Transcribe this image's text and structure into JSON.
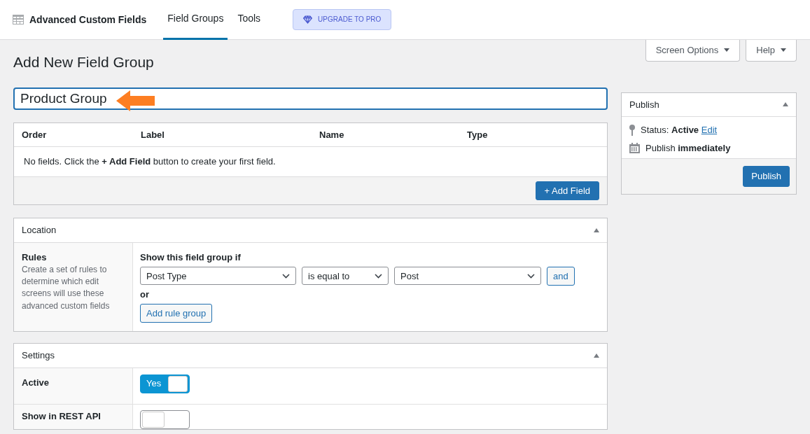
{
  "topbar": {
    "brand": "Advanced Custom Fields",
    "tabs": [
      {
        "label": "Field Groups",
        "selected": true
      },
      {
        "label": "Tools",
        "selected": false
      }
    ],
    "upgrade": "UPGRADE TO PRO"
  },
  "screen_buttons": [
    "Screen Options",
    "Help"
  ],
  "page_title": "Add New Field Group",
  "title_field": {
    "value": "Product Group"
  },
  "fields_table": {
    "columns": [
      "Order",
      "Label",
      "Name",
      "Type"
    ],
    "empty_message": "No fields. Click the **+ Add Field** button to create your first field.",
    "add_button": "+ Add Field"
  },
  "location": {
    "title": "Location",
    "rules_label": "Rules",
    "rules_help": "Create a set of rules to determine which edit screens will use these advanced custom fields",
    "condition_label": "Show this field group if",
    "selects": [
      "Post Type",
      "is equal to",
      "Post"
    ],
    "and_button": "and",
    "or_label": "or",
    "add_group_button": "Add rule group"
  },
  "settings": {
    "title": "Settings",
    "rows": [
      {
        "label": "Active",
        "on": true,
        "toggle_text": "Yes"
      },
      {
        "label": "Show in REST API",
        "on": false
      }
    ]
  },
  "publish": {
    "title": "Publish",
    "status": "Status: **Active**",
    "edit_link": "Edit",
    "schedule": "Publish **immediately**",
    "button": "Publish"
  }
}
